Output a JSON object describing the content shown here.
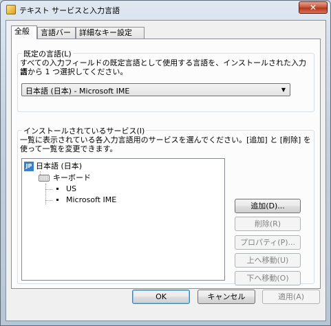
{
  "window": {
    "title": "テキスト サービスと入力言語",
    "close_label": "✕"
  },
  "tabs": [
    {
      "label": "全般",
      "active": true
    },
    {
      "label": "言語バー",
      "active": false
    },
    {
      "label": "詳細なキー設定",
      "active": false
    }
  ],
  "default_language": {
    "group_label": "既定の言語(L)",
    "description_line1": "すべての入力フィールドの既定言語として使用する言語を、インストールされた入力言",
    "description_line2": "語から 1 つ選択してください。",
    "selected_value": "日本語 (日本) - Microsoft IME",
    "dropdown_arrow": "▼"
  },
  "installed_services": {
    "group_label": "インストールされているサービス(I)",
    "description_line1": "一覧に表示されている各入力言語用のサービスを選んでください。[追加] と [削除] を",
    "description_line2": "使って一覧を変更できます。",
    "tree": {
      "language_icon_text": "JP",
      "language": "日本語 (日本)",
      "category": "キーボード",
      "items": [
        "US",
        "Microsoft IME"
      ]
    },
    "buttons": {
      "add": "追加(D)...",
      "remove": "削除(R)",
      "properties": "プロパティ(P)...",
      "move_up": "上へ移動(U)",
      "move_down": "下へ移動(O)"
    }
  },
  "footer": {
    "ok": "OK",
    "cancel": "キャンセル",
    "apply": "適用(A)"
  }
}
